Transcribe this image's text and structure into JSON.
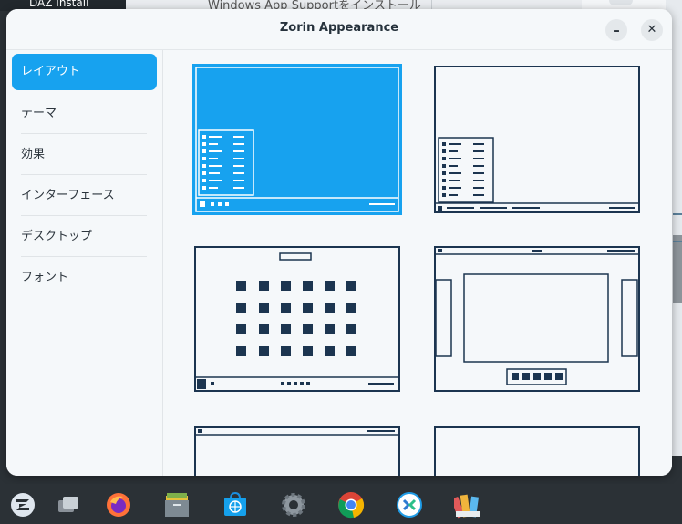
{
  "background": {
    "left_window_title": "DAZ Install",
    "middle_window_title": "Windows App Supportをインストール"
  },
  "window": {
    "title": "Zorin Appearance",
    "minimize_glyph": "–",
    "close_glyph": "✕"
  },
  "sidebar": {
    "items": [
      {
        "label": "レイアウト",
        "active": true
      },
      {
        "label": "テーマ",
        "active": false
      },
      {
        "label": "効果",
        "active": false
      },
      {
        "label": "インターフェース",
        "active": false
      },
      {
        "label": "デスクトップ",
        "active": false
      },
      {
        "label": "フォント",
        "active": false
      }
    ]
  },
  "layouts": [
    {
      "id": "windows-like",
      "selected": true
    },
    {
      "id": "classic-gnome",
      "selected": false
    },
    {
      "id": "touch-layout",
      "selected": false
    },
    {
      "id": "gnome-dock",
      "selected": false
    },
    {
      "id": "top-panel-left",
      "selected": false
    },
    {
      "id": "plain-blank",
      "selected": false
    }
  ],
  "colors": {
    "accent": "#17a2ef",
    "line": "#1c3550",
    "window_bg": "#f5f8fa"
  },
  "taskbar": {
    "apps": [
      {
        "name": "zorin-menu-icon"
      },
      {
        "name": "workspaces-icon"
      },
      {
        "name": "firefox-icon"
      },
      {
        "name": "files-icon"
      },
      {
        "name": "software-store-icon"
      },
      {
        "name": "settings-icon"
      },
      {
        "name": "chrome-icon"
      },
      {
        "name": "zorin-connect-icon"
      },
      {
        "name": "appearance-icon"
      }
    ]
  }
}
